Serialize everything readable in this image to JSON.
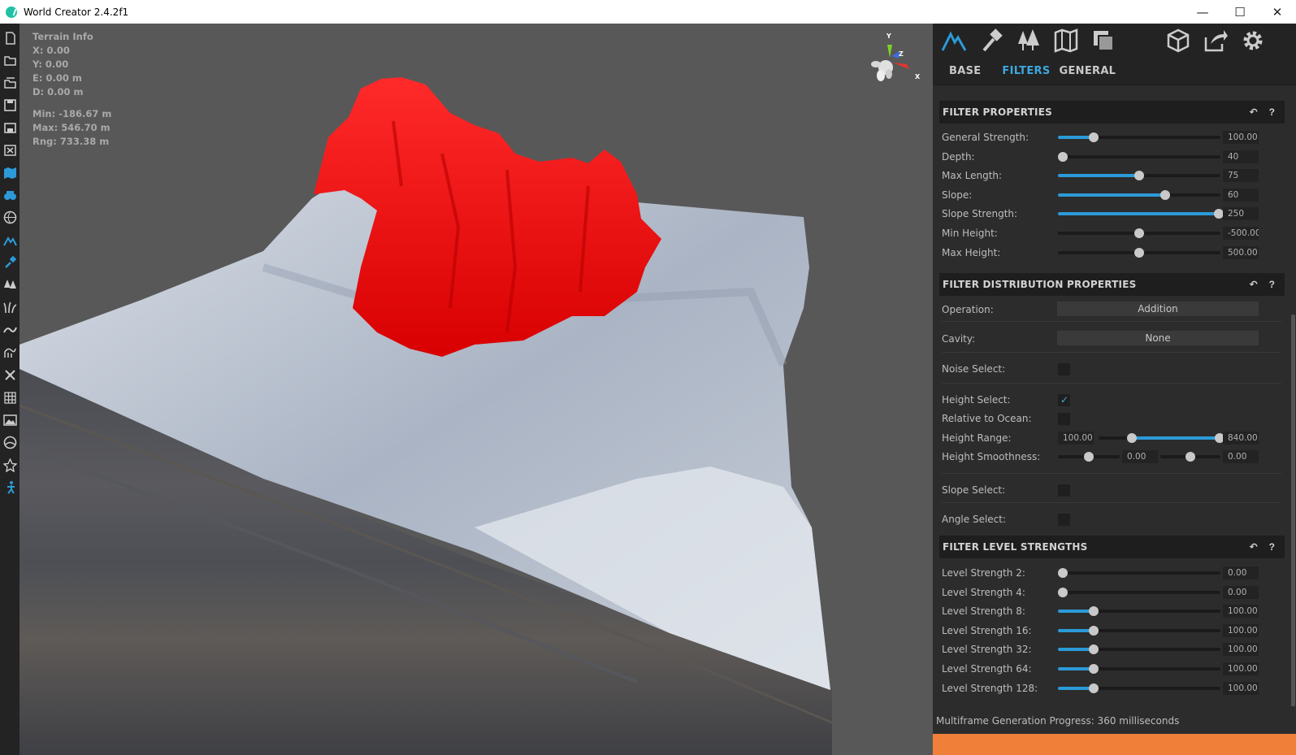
{
  "window": {
    "title": "World Creator 2.4.2f1",
    "minimize": "—",
    "maximize": "☐",
    "close": "✕"
  },
  "terrain_info": {
    "heading": "Terrain Info",
    "x": "X: 0.00",
    "y": "Y: 0.00",
    "e": "E: 0.00 m",
    "d": "D: 0.00 m",
    "min": "Min: -186.67 m",
    "max": "Max: 546.70 m",
    "rng": "Rng: 733.38 m"
  },
  "gizmo": {
    "y": "Y",
    "z": "Z",
    "x": "X"
  },
  "top_icons": [
    "mountain-icon",
    "hammer-icon",
    "trees-icon",
    "map-icon",
    "layers-icon",
    "cube-icon",
    "export-icon",
    "gear-icon"
  ],
  "left_tools": [
    "new-file-icon",
    "open-folder-icon",
    "open-recent-icon",
    "save-icon",
    "save-as-icon",
    "import-icon",
    "map-filter-icon",
    "binoculars-icon",
    "sphere-icon",
    "mountain-icon",
    "paint-icon",
    "trees-icon",
    "grass-icon",
    "river-icon",
    "erosion-icon",
    "cross-icon",
    "grid-icon",
    "image-icon",
    "globe-icon",
    "star-icon",
    "person-icon"
  ],
  "tabs": {
    "base": "BASE",
    "filters": "FILTERS",
    "general": "GENERAL"
  },
  "accent_color": "#2c9ad8",
  "sections": {
    "filter_properties": {
      "title": "FILTER PROPERTIES",
      "rows": [
        {
          "label": "General Strength:",
          "value": "100.00",
          "fraction": 0.22,
          "fill": true
        },
        {
          "label": "Depth:",
          "value": "40",
          "fraction": 0.03,
          "fill": false
        },
        {
          "label": "Max Length:",
          "value": "75",
          "fraction": 0.5,
          "fill": true
        },
        {
          "label": "Slope:",
          "value": "60",
          "fraction": 0.66,
          "fill": true
        },
        {
          "label": "Slope Strength:",
          "value": "250",
          "fraction": 0.99,
          "fill": true
        },
        {
          "label": "Min Height:",
          "value": "-500.00",
          "fraction": 0.5,
          "fill": false
        },
        {
          "label": "Max Height:",
          "value": "500.00",
          "fraction": 0.5,
          "fill": false
        }
      ]
    },
    "filter_distribution": {
      "title": "FILTER DISTRIBUTION PROPERTIES",
      "operation_label": "Operation:",
      "operation_value": "Addition",
      "cavity_label": "Cavity:",
      "cavity_value": "None",
      "noise_select": "Noise Select:",
      "height_select": "Height Select:",
      "height_select_check": "✓",
      "relative_to_ocean": "Relative to Ocean:",
      "height_range": {
        "label": "Height Range:",
        "min": "100.00",
        "max": "840.00",
        "from": 0.27,
        "to": 0.99
      },
      "height_smoothness": {
        "label": "Height Smoothness:",
        "a": "0.00",
        "b": "0.00"
      },
      "slope_select": "Slope Select:",
      "angle_select": "Angle Select:"
    },
    "filter_level_strengths": {
      "title": "FILTER LEVEL STRENGTHS",
      "rows": [
        {
          "label": "Level Strength 2:",
          "value": "0.00",
          "fraction": 0.03,
          "fill": false
        },
        {
          "label": "Level Strength 4:",
          "value": "0.00",
          "fraction": 0.03,
          "fill": false
        },
        {
          "label": "Level Strength 8:",
          "value": "100.00",
          "fraction": 0.22,
          "fill": true
        },
        {
          "label": "Level Strength 16:",
          "value": "100.00",
          "fraction": 0.22,
          "fill": true
        },
        {
          "label": "Level Strength 32:",
          "value": "100.00",
          "fraction": 0.22,
          "fill": true
        },
        {
          "label": "Level Strength 64:",
          "value": "100.00",
          "fraction": 0.22,
          "fill": true
        },
        {
          "label": "Level Strength 128:",
          "value": "100.00",
          "fraction": 0.22,
          "fill": true
        }
      ]
    }
  },
  "status": {
    "text": "Multiframe Generation Progress: 360 milliseconds",
    "progress": 1.0,
    "color": "#f07f3a"
  }
}
